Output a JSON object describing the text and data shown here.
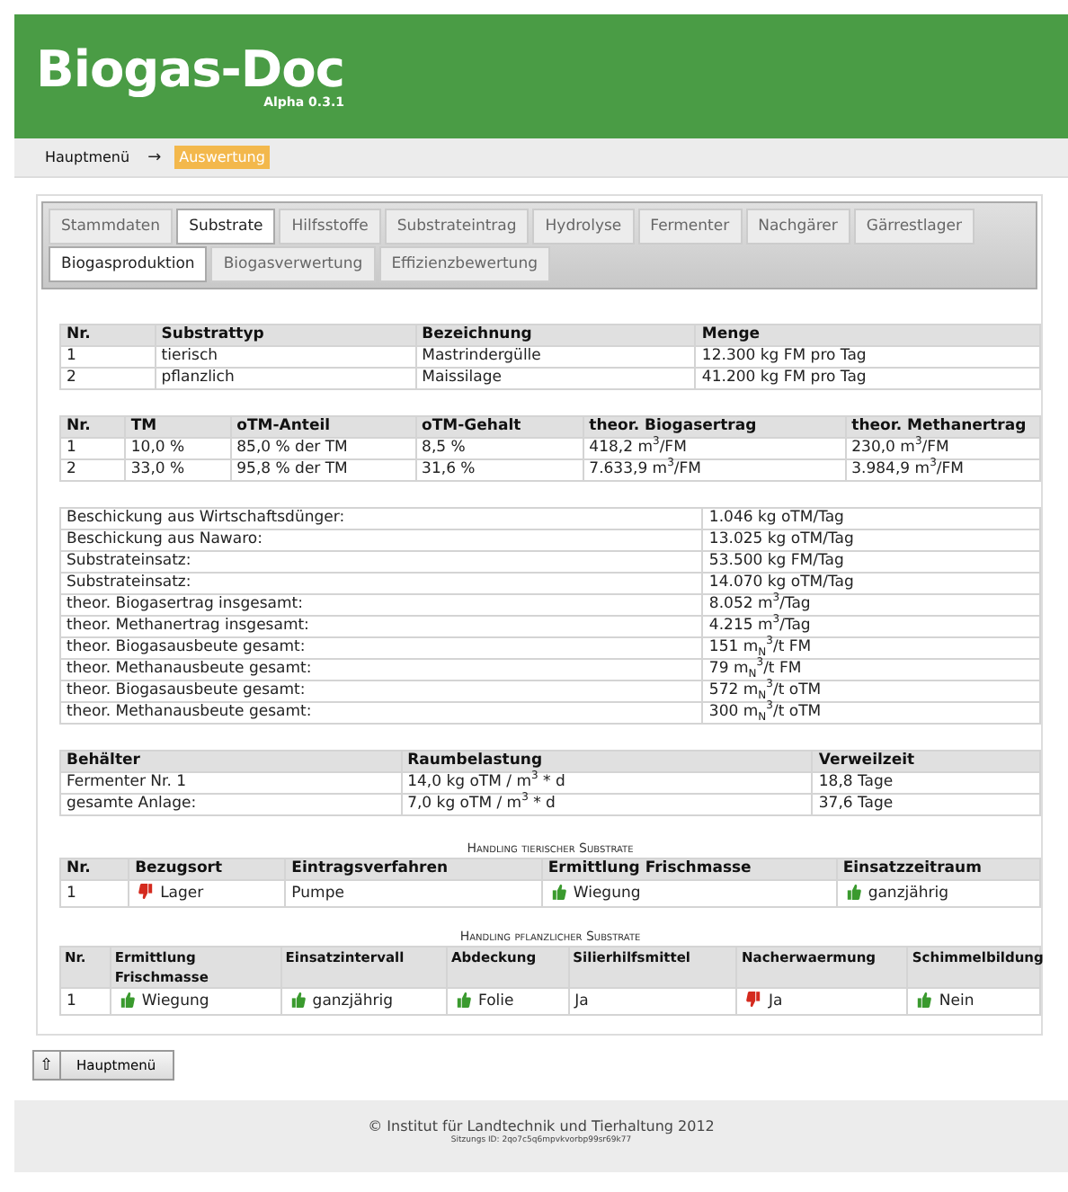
{
  "app": {
    "title": "Biogas-Doc",
    "version": "Alpha 0.3.1"
  },
  "breadcrumb": {
    "items": [
      {
        "label": "Hauptmenü",
        "selected": false
      },
      {
        "label": "Auswertung",
        "selected": true
      }
    ],
    "separator": "→"
  },
  "tab_rows": [
    {
      "tabs": [
        {
          "label": "Stammdaten",
          "selected": false
        },
        {
          "label": "Substrate",
          "selected": true
        },
        {
          "label": "Hilfsstoffe",
          "selected": false
        },
        {
          "label": "Substrateintrag",
          "selected": false
        },
        {
          "label": "Hydrolyse",
          "selected": false
        },
        {
          "label": "Fermenter",
          "selected": false
        },
        {
          "label": "Nachgärer",
          "selected": false
        },
        {
          "label": "Gärrestlager",
          "selected": false
        }
      ]
    },
    {
      "tabs": [
        {
          "label": "Biogasproduktion",
          "selected": true
        },
        {
          "label": "Biogasverwertung",
          "selected": false
        },
        {
          "label": "Effizienzbewertung",
          "selected": false
        }
      ]
    }
  ],
  "tables": [
    {
      "kind": "grid",
      "columns": [
        "Nr.",
        "Substrattyp",
        "Bezeichnung",
        "Menge"
      ],
      "rows": [
        [
          "1",
          "tierisch",
          "Mastrindergülle",
          "12.300 kg FM pro Tag"
        ],
        [
          "2",
          "pflanzlich",
          "Maissilage",
          "41.200 kg FM pro Tag"
        ]
      ]
    },
    {
      "kind": "grid",
      "columns": [
        "Nr.",
        "TM",
        "oTM-Anteil",
        "oTM-Gehalt",
        "theor. Biogasertrag",
        "theor. Methanertrag"
      ],
      "rows": [
        [
          "1",
          "10,0 %",
          "85,0 % der TM",
          "8,5 %",
          "418,2 m$^{3}$/FM",
          "230,0 m$^{3}$/FM"
        ],
        [
          "2",
          "33,0 %",
          "95,8 % der TM",
          "31,6 %",
          "7.633,9 m$^{3}$/FM",
          "3.984,9 m$^{3}$/FM"
        ]
      ]
    },
    {
      "kind": "summary",
      "rows": [
        [
          "Beschickung aus Wirtschaftsdünger:",
          "1.046 kg oTM/Tag"
        ],
        [
          "Beschickung aus Nawaro:",
          "13.025 kg oTM/Tag"
        ],
        [
          "Substrateinsatz:",
          "53.500 kg FM/Tag"
        ],
        [
          "Substrateinsatz:",
          "14.070 kg oTM/Tag"
        ],
        [
          "theor. Biogasertrag insgesamt:",
          "8.052 m$^{3}$/Tag"
        ],
        [
          "theor. Methanertrag insgesamt:",
          "4.215 m$^{3}$/Tag"
        ],
        [
          "theor. Biogasausbeute gesamt:",
          "151 m$_{N}$$^{3}$/t FM"
        ],
        [
          "theor. Methanausbeute gesamt:",
          "79 m$_{N}$$^{3}$/t FM"
        ],
        [
          "theor. Biogasausbeute gesamt:",
          "572 m$_{N}$$^{3}$/t oTM"
        ],
        [
          "theor. Methanausbeute gesamt:",
          "300 m$_{N}$$^{3}$/t oTM"
        ]
      ]
    },
    {
      "kind": "grid",
      "columns": [
        "Behälter",
        "Raumbelastung",
        "Verweilzeit"
      ],
      "rows": [
        [
          "Fermenter Nr. 1",
          "14,0 kg oTM / m$^{3}$ * d",
          "18,8 Tage"
        ],
        [
          "gesamte Anlage:",
          "7,0 kg oTM / m$^{3}$ * d",
          "37,6 Tage"
        ]
      ]
    },
    {
      "kind": "rated",
      "title": "Handling tierischer Substrate",
      "columns": [
        "Nr.",
        "Bezugsort",
        "Eintragsverfahren",
        "Ermittlung Frischmasse",
        "Einsatzzeitraum"
      ],
      "rows": [
        [
          {
            "text": "1"
          },
          {
            "text": "Lager",
            "approved": false
          },
          {
            "text": "Pumpe"
          },
          {
            "text": "Wiegung",
            "approved": true
          },
          {
            "text": "ganzjährig",
            "approved": true
          }
        ]
      ]
    },
    {
      "kind": "rated",
      "title": "Handling pflanzlicher Substrate",
      "columns": [
        "Nr.",
        "Ermittlung Frischmasse",
        "Einsatzintervall",
        "Abdeckung",
        "Silierhilfsmittel",
        "Nacherwaermung",
        "Schimmelbildung"
      ],
      "rows": [
        [
          {
            "text": "1"
          },
          {
            "text": "Wiegung",
            "approved": true
          },
          {
            "text": "ganzjährig",
            "approved": true
          },
          {
            "text": "Folie",
            "approved": true
          },
          {
            "text": "Ja"
          },
          {
            "text": "Ja",
            "approved": false
          },
          {
            "text": "Nein",
            "approved": true
          }
        ]
      ]
    }
  ],
  "back_button": {
    "icon": "⇧",
    "label": "Hauptmenü"
  },
  "footer": {
    "copyright": "© Institut für Landtechnik und Tierhaltung 2012",
    "session": "Sitzungs ID: 2qo7c5q6mpvkvorbp99sr69k77"
  }
}
